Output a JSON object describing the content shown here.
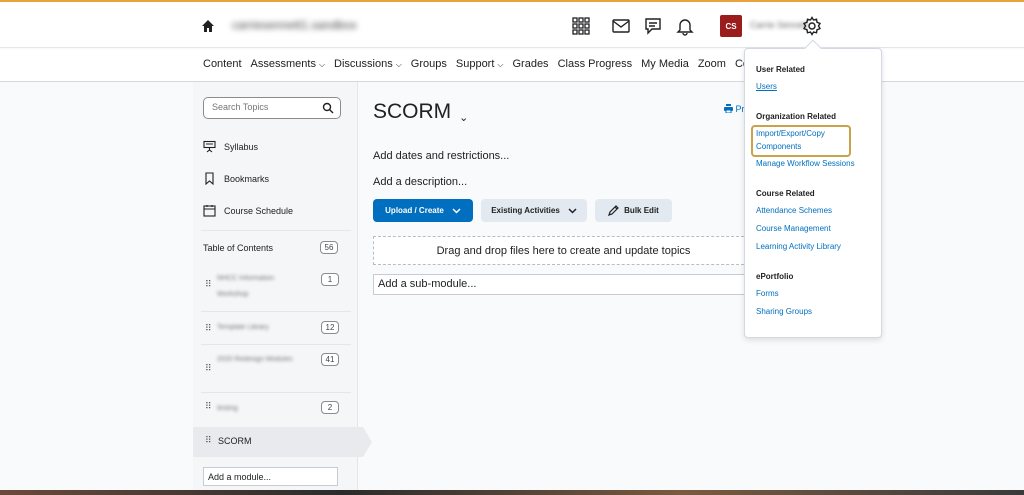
{
  "colors": {
    "accent": "#006fbf",
    "avatar_bg": "#9b1c1c",
    "highlight": "#c9a24b",
    "top_stripe": "#e8a33c"
  },
  "minibar": {
    "org_name": "carriesennett1.sandbox",
    "avatar_initials": "CS",
    "user_name": "Carrie Sennett",
    "icons": [
      "home-icon",
      "grid-icon",
      "mail-icon",
      "chat-icon",
      "bell-icon",
      "gear-icon"
    ]
  },
  "navbar": {
    "items": [
      {
        "label": "Content",
        "caret": false
      },
      {
        "label": "Assessments",
        "caret": true
      },
      {
        "label": "Discussions",
        "caret": true
      },
      {
        "label": "Groups",
        "caret": false
      },
      {
        "label": "Support",
        "caret": true
      },
      {
        "label": "Grades",
        "caret": false
      },
      {
        "label": "Class Progress",
        "caret": false
      },
      {
        "label": "My Media",
        "caret": false
      },
      {
        "label": "Zoom",
        "caret": false
      },
      {
        "label": "Course",
        "caret": false
      }
    ]
  },
  "sidebar": {
    "search_placeholder": "Search Topics",
    "syllabus": "Syllabus",
    "bookmarks": "Bookmarks",
    "course_schedule": "Course Schedule",
    "toc_label": "Table of Contents",
    "toc_count": "56",
    "modules": [
      {
        "name": "NHCC Information Workshop",
        "count": "1"
      },
      {
        "name": "Template Library",
        "count": "12"
      },
      {
        "name": "2020 Redesign Modules",
        "count": "41"
      },
      {
        "name": "testing",
        "count": "2"
      }
    ],
    "active_module": "SCORM",
    "add_module": "Add a module..."
  },
  "main": {
    "title": "SCORM",
    "title_caret": "⌄",
    "print": "Pr",
    "add_dates": "Add dates and restrictions...",
    "add_description": "Add a description...",
    "upload_create": "Upload / Create",
    "existing_activities": "Existing Activities",
    "bulk_edit": "Bulk Edit",
    "dropzone": "Drag and drop files here to create and update topics",
    "add_submodule": "Add a sub-module..."
  },
  "admin_menu": {
    "user_related": {
      "heading": "User Related",
      "links": [
        "Users"
      ]
    },
    "organization_related": {
      "heading": "Organization Related",
      "links": [
        "Import/Export/Copy Components",
        "Manage Workflow Sessions"
      ]
    },
    "course_related": {
      "heading": "Course Related",
      "links": [
        "Attendance Schemes",
        "Course Management",
        "Learning Activity Library"
      ]
    },
    "eportfolio": {
      "heading": "ePortfolio",
      "links": [
        "Forms",
        "Sharing Groups"
      ]
    },
    "import_line1": "Import/Export/Copy",
    "import_line2": "Components"
  }
}
